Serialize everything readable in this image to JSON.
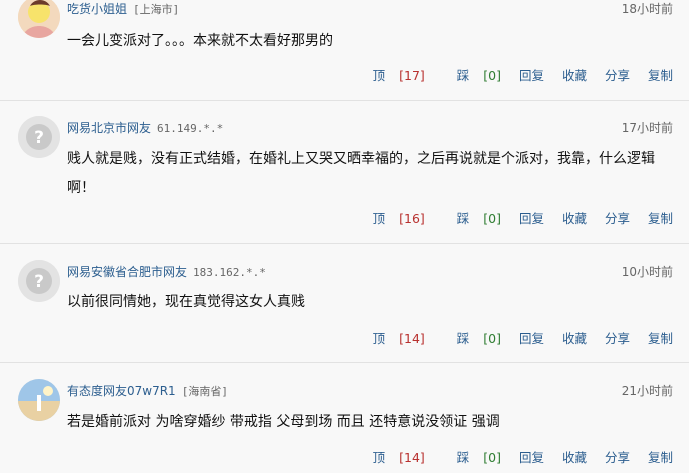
{
  "comments": [
    {
      "user": "吃货小姐姐",
      "meta": "[上海市]",
      "time": "18小时前",
      "text": "一会儿变派对了。。。本来就不太看好那男的",
      "avatar": "photo",
      "up": "顶",
      "up_count": "[17]",
      "down": "踩",
      "down_count": "[0]",
      "reply": "回复",
      "collect": "收藏",
      "share": "分享",
      "copy": "复制"
    },
    {
      "user": "网易北京市网友",
      "meta": "61.149.*.*",
      "time": "17小时前",
      "text": "贱人就是贱，没有正式结婚，在婚礼上又哭又晒幸福的，之后再说就是个派对，我靠，什么逻辑啊！",
      "avatar": "default",
      "up": "顶",
      "up_count": "[16]",
      "down": "踩",
      "down_count": "[0]",
      "reply": "回复",
      "collect": "收藏",
      "share": "分享",
      "copy": "复制"
    },
    {
      "user": "网易安徽省合肥市网友",
      "meta": "183.162.*.*",
      "time": "10小时前",
      "text": "以前很同情她，现在真觉得这女人真贱",
      "avatar": "default",
      "up": "顶",
      "up_count": "[14]",
      "down": "踩",
      "down_count": "[0]",
      "reply": "回复",
      "collect": "收藏",
      "share": "分享",
      "copy": "复制"
    },
    {
      "user": "有态度网友07w7R1",
      "meta": "[海南省]",
      "time": "21小时前",
      "text": "若是婚前派对 为啥穿婚纱 带戒指 父母到场 而且 还特意说没领证 强调",
      "avatar": "beach",
      "up": "顶",
      "up_count": "[14]",
      "down": "踩",
      "down_count": "[0]",
      "reply": "回复",
      "collect": "收藏",
      "share": "分享",
      "copy": "复制"
    }
  ],
  "colors": {
    "link": "#2c5e8f",
    "up_count": "#b8312f",
    "down_count": "#2f7d32"
  }
}
